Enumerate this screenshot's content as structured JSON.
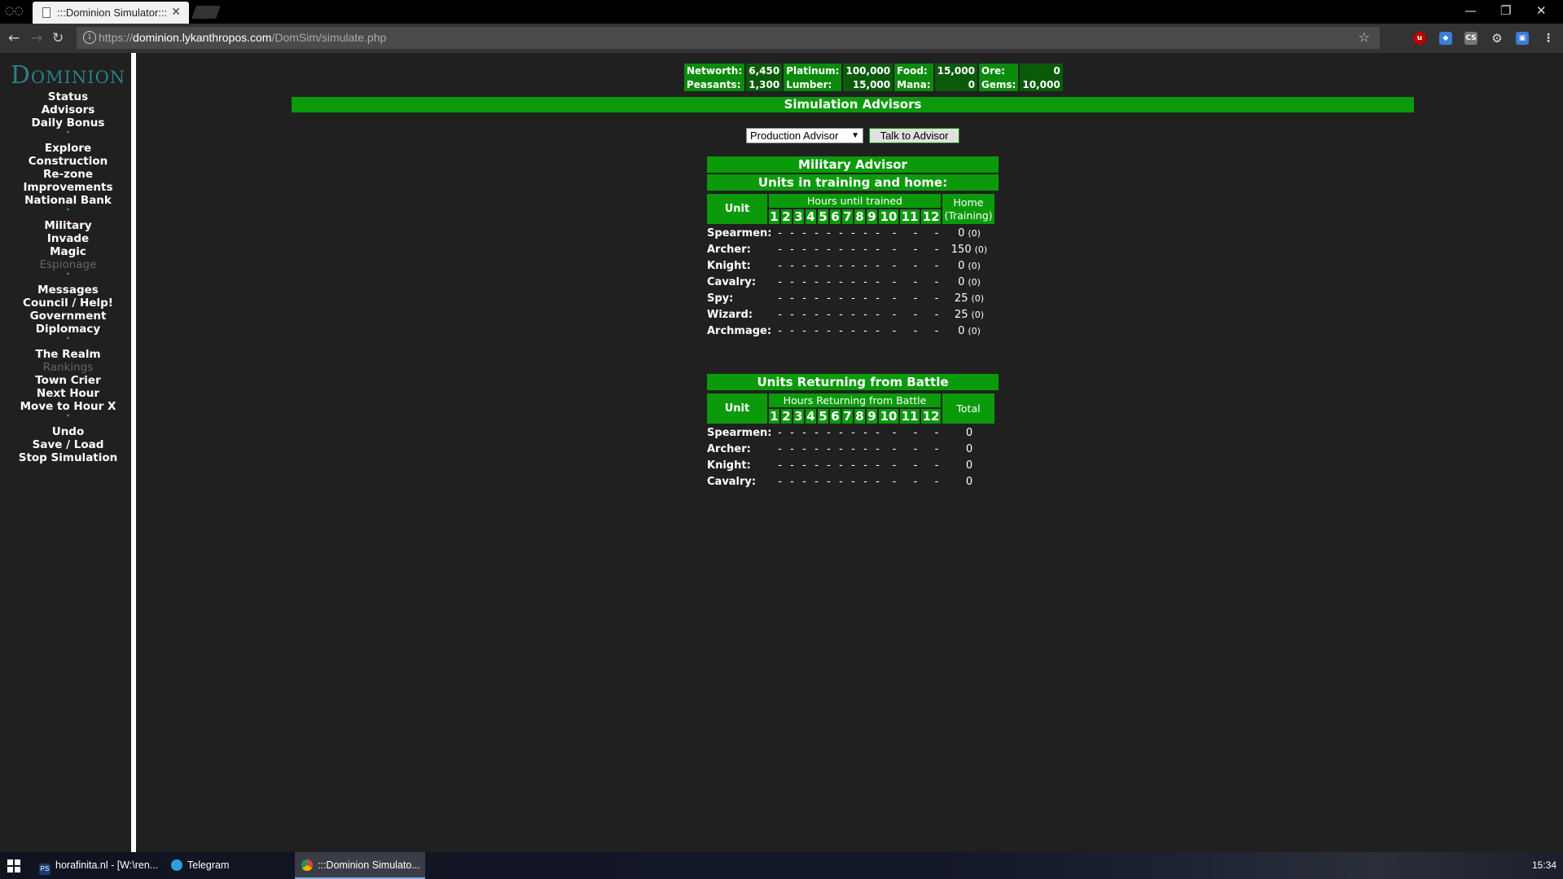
{
  "browser": {
    "tab_title": ":::Dominion Simulator:::",
    "url_scheme": "https://",
    "url_host": "dominion.lykanthropos.com",
    "url_path": "/DomSim/simulate.php"
  },
  "sidebar": {
    "logo": "Dominion",
    "groups": [
      [
        {
          "label": "Status"
        },
        {
          "label": "Advisors"
        },
        {
          "label": "Daily Bonus"
        }
      ],
      [
        {
          "label": "Explore"
        },
        {
          "label": "Construction"
        },
        {
          "label": "Re-zone"
        },
        {
          "label": "Improvements"
        },
        {
          "label": "National Bank"
        }
      ],
      [
        {
          "label": "Military"
        },
        {
          "label": "Invade"
        },
        {
          "label": "Magic"
        },
        {
          "label": "Espionage",
          "disabled": true
        }
      ],
      [
        {
          "label": "Messages"
        },
        {
          "label": "Council / Help!"
        },
        {
          "label": "Government"
        },
        {
          "label": "Diplomacy"
        }
      ],
      [
        {
          "label": "The Realm"
        },
        {
          "label": "Rankings",
          "disabled": true
        },
        {
          "label": "Town Crier"
        },
        {
          "label": "Next Hour"
        },
        {
          "label": "Move to Hour X"
        }
      ],
      [
        {
          "label": "Undo"
        },
        {
          "label": "Save / Load"
        },
        {
          "label": "Stop Simulation"
        }
      ]
    ],
    "separator": "•"
  },
  "stats": {
    "networth_label": "Networth:",
    "networth": "6,450",
    "platinum_label": "Platinum:",
    "platinum": "100,000",
    "food_label": "Food:",
    "food": "15,000",
    "ore_label": "Ore:",
    "ore": "0",
    "peasants_label": "Peasants:",
    "peasants": "1,300",
    "lumber_label": "Lumber:",
    "lumber": "15,000",
    "mana_label": "Mana:",
    "mana": "0",
    "gems_label": "Gems:",
    "gems": "10,000"
  },
  "main": {
    "section_title": "Simulation Advisors",
    "advisor_select": "Production Advisor",
    "talk_button": "Talk to Advisor"
  },
  "military": {
    "title": "Military Advisor",
    "training_title": "Units in training and home:",
    "col_unit": "Unit",
    "col_hours": "Hours until trained",
    "col_home_1": "Home",
    "col_home_2": "(Training)",
    "hours": [
      "1",
      "2",
      "3",
      "4",
      "5",
      "6",
      "7",
      "8",
      "9",
      "10",
      "11",
      "12"
    ],
    "units": [
      {
        "name": "Spearmen:",
        "home": "0",
        "training": "(0)"
      },
      {
        "name": "Archer:",
        "home": "150",
        "training": "(0)"
      },
      {
        "name": "Knight:",
        "home": "0",
        "training": "(0)"
      },
      {
        "name": "Cavalry:",
        "home": "0",
        "training": "(0)"
      },
      {
        "name": "Spy:",
        "home": "25",
        "training": "(0)"
      },
      {
        "name": "Wizard:",
        "home": "25",
        "training": "(0)"
      },
      {
        "name": "Archmage:",
        "home": "0",
        "training": "(0)"
      }
    ],
    "dash": "-"
  },
  "returning": {
    "title": "Units Returning from Battle",
    "col_unit": "Unit",
    "col_hours": "Hours Returning from Battle",
    "col_total": "Total",
    "units": [
      {
        "name": "Spearmen:",
        "total": "0"
      },
      {
        "name": "Archer:",
        "total": "0"
      },
      {
        "name": "Knight:",
        "total": "0"
      },
      {
        "name": "Cavalry:",
        "total": "0"
      }
    ]
  },
  "taskbar": {
    "tasks": [
      {
        "label": "horafinita.nl - [W:\\ren...",
        "icon": "powershell-icon"
      },
      {
        "label": "Telegram",
        "icon": "telegram-icon"
      },
      {
        "label": ":::Dominion Simulato...",
        "icon": "chrome-icon"
      }
    ],
    "clock": "15:34"
  },
  "colors": {
    "accent_green": "#0a9a0a",
    "dark_green": "#0a5a0a",
    "background": "#202020"
  }
}
